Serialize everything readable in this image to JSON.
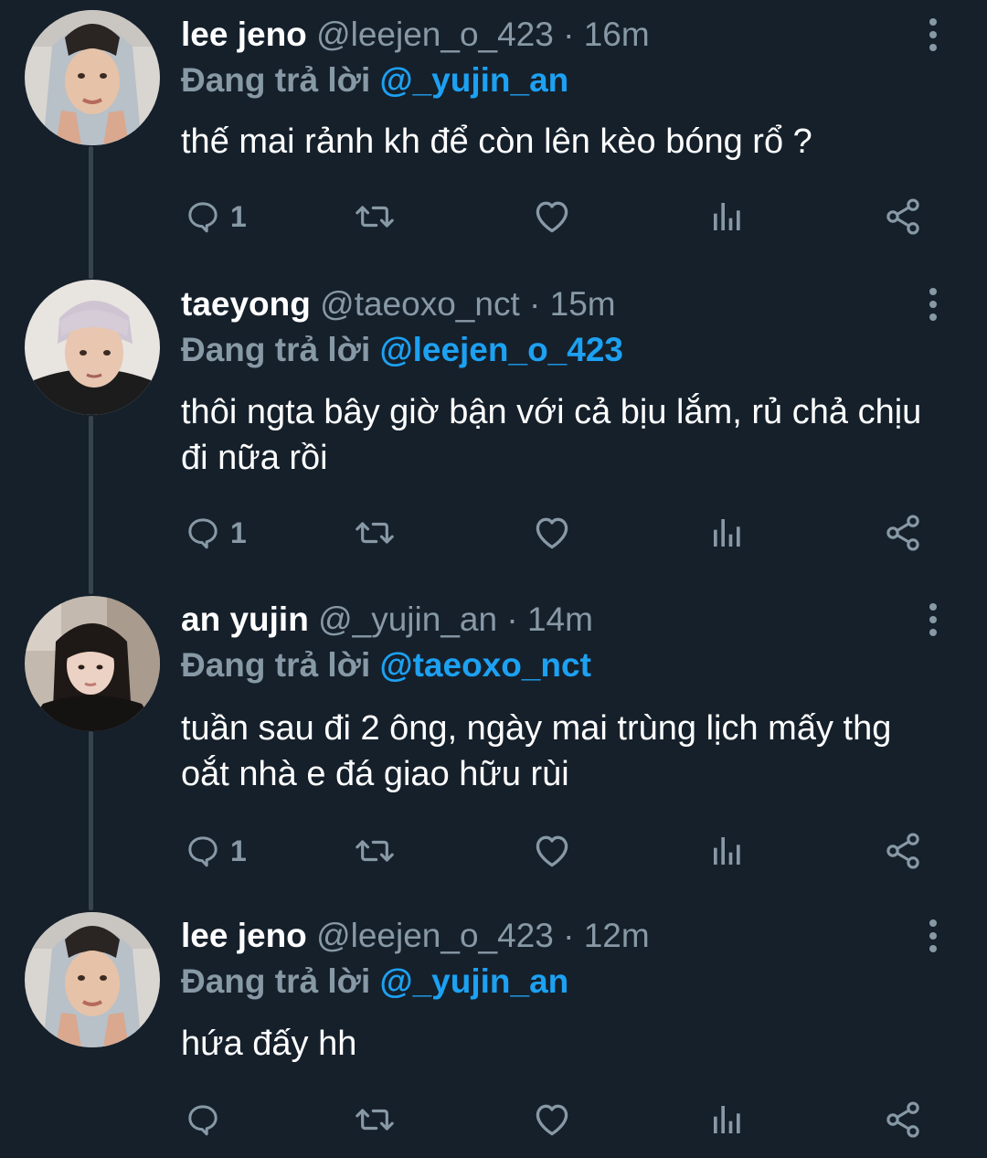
{
  "colors": {
    "background": "#15202b",
    "secondary_text": "#8899a6",
    "mention": "#1da1f2",
    "thread_line": "#38444d"
  },
  "tweets": [
    {
      "name": "lee jeno",
      "handle": "@leejen_o_423",
      "separator": "·",
      "time": "16m",
      "reply_prefix": "Đang trả lời",
      "reply_to": "@_yujin_an",
      "text": "thế mai rảnh kh để còn lên kèo bóng rổ ?",
      "reply_count": "1",
      "avatar_icon": "avatar-photo-lee-jeno"
    },
    {
      "name": "taeyong",
      "handle": "@taeoxo_nct",
      "separator": "·",
      "time": "15m",
      "reply_prefix": "Đang trả lời",
      "reply_to": "@leejen_o_423",
      "text": "thôi ngta bây giờ bận với cả bịu lắm, rủ chả chịu đi nữa rồi",
      "reply_count": "1",
      "avatar_icon": "avatar-photo-taeyong"
    },
    {
      "name": "an yujin",
      "handle": "@_yujin_an",
      "separator": "·",
      "time": "14m",
      "reply_prefix": "Đang trả lời",
      "reply_to": "@taeoxo_nct",
      "text": "tuần sau đi 2 ông, ngày mai trùng lịch mấy thg oắt nhà e đá giao hữu rùi",
      "reply_count": "1",
      "avatar_icon": "avatar-photo-an-yujin"
    },
    {
      "name": "lee jeno",
      "handle": "@leejen_o_423",
      "separator": "·",
      "time": "12m",
      "reply_prefix": "Đang trả lời",
      "reply_to": "@_yujin_an",
      "text": "hứa đấy hh",
      "reply_count": "",
      "avatar_icon": "avatar-photo-lee-jeno"
    }
  ]
}
